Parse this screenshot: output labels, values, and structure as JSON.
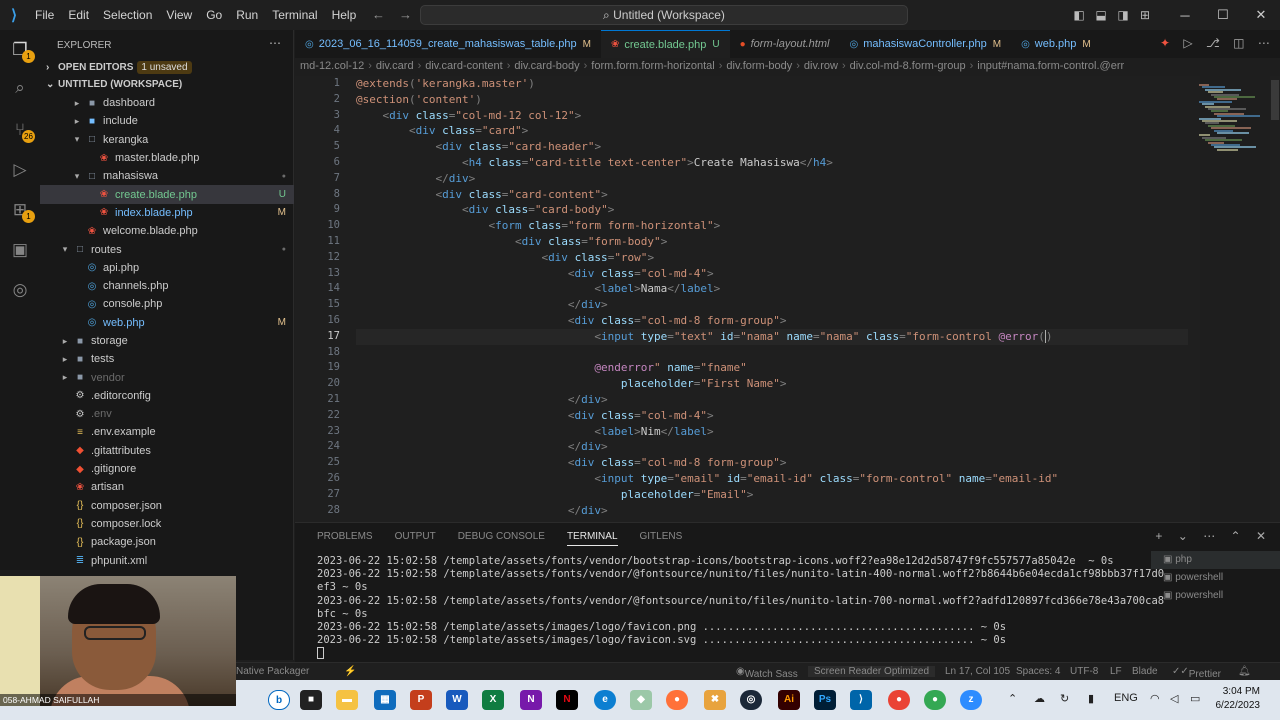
{
  "window": {
    "title": "Untitled (Workspace)",
    "menu": [
      "File",
      "Edit",
      "Selection",
      "View",
      "Go",
      "Run",
      "Terminal",
      "Help"
    ]
  },
  "sidebar": {
    "title": "EXPLORER",
    "open_editors": "OPEN EDITORS",
    "unsaved_badge": "1 unsaved",
    "workspace": "UNTITLED (WORKSPACE)",
    "tree": [
      {
        "label": "dashboard",
        "type": "folder",
        "indent": 2,
        "status": ""
      },
      {
        "label": "include",
        "type": "folder-blue",
        "indent": 2,
        "status": ""
      },
      {
        "label": "kerangka",
        "type": "folder-open",
        "indent": 2,
        "status": ""
      },
      {
        "label": "master.blade.php",
        "type": "blade",
        "indent": 3,
        "status": ""
      },
      {
        "label": "mahasiswa",
        "type": "folder-open",
        "indent": 2,
        "status": "dot"
      },
      {
        "label": "create.blade.php",
        "type": "blade",
        "indent": 3,
        "status": "U"
      },
      {
        "label": "index.blade.php",
        "type": "blade",
        "indent": 3,
        "status": "M"
      },
      {
        "label": "welcome.blade.php",
        "type": "blade",
        "indent": 2,
        "status": ""
      },
      {
        "label": "routes",
        "type": "folder-open",
        "indent": 1,
        "status": "dot"
      },
      {
        "label": "api.php",
        "type": "php",
        "indent": 2,
        "status": ""
      },
      {
        "label": "channels.php",
        "type": "php",
        "indent": 2,
        "status": ""
      },
      {
        "label": "console.php",
        "type": "php",
        "indent": 2,
        "status": ""
      },
      {
        "label": "web.php",
        "type": "php",
        "indent": 2,
        "status": "M"
      },
      {
        "label": "storage",
        "type": "folder",
        "indent": 1,
        "status": ""
      },
      {
        "label": "tests",
        "type": "folder",
        "indent": 1,
        "status": ""
      },
      {
        "label": "vendor",
        "type": "folder",
        "indent": 1,
        "status": ""
      },
      {
        "label": ".editorconfig",
        "type": "gear",
        "indent": 1,
        "status": ""
      },
      {
        "label": ".env",
        "type": "gear",
        "indent": 1,
        "status": ""
      },
      {
        "label": ".env.example",
        "type": "env",
        "indent": 1,
        "status": ""
      },
      {
        "label": ".gitattributes",
        "type": "git",
        "indent": 1,
        "status": ""
      },
      {
        "label": ".gitignore",
        "type": "git",
        "indent": 1,
        "status": ""
      },
      {
        "label": "artisan",
        "type": "blade",
        "indent": 1,
        "status": ""
      },
      {
        "label": "composer.json",
        "type": "json",
        "indent": 1,
        "status": ""
      },
      {
        "label": "composer.lock",
        "type": "json",
        "indent": 1,
        "status": ""
      },
      {
        "label": "package.json",
        "type": "json",
        "indent": 1,
        "status": ""
      },
      {
        "label": "phpunit.xml",
        "type": "xml",
        "indent": 1,
        "status": ""
      }
    ]
  },
  "tabs": [
    {
      "label": "2023_06_16_114059_create_mahasiswas_table.php",
      "mark": "M",
      "icon": "php",
      "active": false
    },
    {
      "label": "create.blade.php",
      "mark": "U",
      "icon": "blade",
      "active": true
    },
    {
      "label": "form-layout.html",
      "mark": "",
      "icon": "dot",
      "active": false
    },
    {
      "label": "mahasiswaController.php",
      "mark": "M",
      "icon": "php",
      "active": false
    },
    {
      "label": "web.php",
      "mark": "M",
      "icon": "php",
      "active": false
    }
  ],
  "breadcrumb": [
    "md-12.col-12",
    "div.card",
    "div.card-content",
    "div.card-body",
    "form.form.form-horizontal",
    "div.form-body",
    "div.row",
    "div.col-md-8.form-group",
    "input#nama.form-control.@err"
  ],
  "editor": {
    "current_line": 17,
    "lines": [
      [
        [
          "dir",
          "@extends"
        ],
        [
          "p",
          "("
        ],
        [
          "str",
          "'kerangka.master'"
        ],
        [
          "p",
          ")"
        ]
      ],
      [
        [
          "dir",
          "@section"
        ],
        [
          "p",
          "("
        ],
        [
          "str",
          "'content'"
        ],
        [
          "p",
          ")"
        ]
      ],
      [
        [
          "txt",
          "    "
        ],
        [
          "p",
          "<"
        ],
        [
          "tag",
          "div"
        ],
        [
          "txt",
          " "
        ],
        [
          "at",
          "class"
        ],
        [
          "p",
          "="
        ],
        [
          "str",
          "\"col-md-12 col-12\""
        ],
        [
          "p",
          ">"
        ]
      ],
      [
        [
          "txt",
          "        "
        ],
        [
          "p",
          "<"
        ],
        [
          "tag",
          "div"
        ],
        [
          "txt",
          " "
        ],
        [
          "at",
          "class"
        ],
        [
          "p",
          "="
        ],
        [
          "str",
          "\"card\""
        ],
        [
          "p",
          ">"
        ]
      ],
      [
        [
          "txt",
          "            "
        ],
        [
          "p",
          "<"
        ],
        [
          "tag",
          "div"
        ],
        [
          "txt",
          " "
        ],
        [
          "at",
          "class"
        ],
        [
          "p",
          "="
        ],
        [
          "str",
          "\"card-header\""
        ],
        [
          "p",
          ">"
        ]
      ],
      [
        [
          "txt",
          "                "
        ],
        [
          "p",
          "<"
        ],
        [
          "tag",
          "h4"
        ],
        [
          "txt",
          " "
        ],
        [
          "at",
          "class"
        ],
        [
          "p",
          "="
        ],
        [
          "str",
          "\"card-title text-center\""
        ],
        [
          "p",
          ">"
        ],
        [
          "txt",
          "Create Mahasiswa"
        ],
        [
          "p",
          "</"
        ],
        [
          "tag",
          "h4"
        ],
        [
          "p",
          ">"
        ]
      ],
      [
        [
          "txt",
          "            "
        ],
        [
          "p",
          "</"
        ],
        [
          "tag",
          "div"
        ],
        [
          "p",
          ">"
        ]
      ],
      [
        [
          "txt",
          "            "
        ],
        [
          "p",
          "<"
        ],
        [
          "tag",
          "div"
        ],
        [
          "txt",
          " "
        ],
        [
          "at",
          "class"
        ],
        [
          "p",
          "="
        ],
        [
          "str",
          "\"card-content\""
        ],
        [
          "p",
          ">"
        ]
      ],
      [
        [
          "txt",
          "                "
        ],
        [
          "p",
          "<"
        ],
        [
          "tag",
          "div"
        ],
        [
          "txt",
          " "
        ],
        [
          "at",
          "class"
        ],
        [
          "p",
          "="
        ],
        [
          "str",
          "\"card-body\""
        ],
        [
          "p",
          ">"
        ]
      ],
      [
        [
          "txt",
          "                    "
        ],
        [
          "p",
          "<"
        ],
        [
          "tag",
          "form"
        ],
        [
          "txt",
          " "
        ],
        [
          "at",
          "class"
        ],
        [
          "p",
          "="
        ],
        [
          "str",
          "\"form form-horizontal\""
        ],
        [
          "p",
          ">"
        ]
      ],
      [
        [
          "txt",
          "                        "
        ],
        [
          "p",
          "<"
        ],
        [
          "tag",
          "div"
        ],
        [
          "txt",
          " "
        ],
        [
          "at",
          "class"
        ],
        [
          "p",
          "="
        ],
        [
          "str",
          "\"form-body\""
        ],
        [
          "p",
          ">"
        ]
      ],
      [
        [
          "txt",
          "                            "
        ],
        [
          "p",
          "<"
        ],
        [
          "tag",
          "div"
        ],
        [
          "txt",
          " "
        ],
        [
          "at",
          "class"
        ],
        [
          "p",
          "="
        ],
        [
          "str",
          "\"row\""
        ],
        [
          "p",
          ">"
        ]
      ],
      [
        [
          "txt",
          "                                "
        ],
        [
          "p",
          "<"
        ],
        [
          "tag",
          "div"
        ],
        [
          "txt",
          " "
        ],
        [
          "at",
          "class"
        ],
        [
          "p",
          "="
        ],
        [
          "str",
          "\"col-md-4\""
        ],
        [
          "p",
          ">"
        ]
      ],
      [
        [
          "txt",
          "                                    "
        ],
        [
          "p",
          "<"
        ],
        [
          "tag",
          "label"
        ],
        [
          "p",
          ">"
        ],
        [
          "txt",
          "Nama"
        ],
        [
          "p",
          "</"
        ],
        [
          "tag",
          "label"
        ],
        [
          "p",
          ">"
        ]
      ],
      [
        [
          "txt",
          "                                "
        ],
        [
          "p",
          "</"
        ],
        [
          "tag",
          "div"
        ],
        [
          "p",
          ">"
        ]
      ],
      [
        [
          "txt",
          "                                "
        ],
        [
          "p",
          "<"
        ],
        [
          "tag",
          "div"
        ],
        [
          "txt",
          " "
        ],
        [
          "at",
          "class"
        ],
        [
          "p",
          "="
        ],
        [
          "str",
          "\"col-md-8 form-group\""
        ],
        [
          "p",
          ">"
        ]
      ],
      [
        [
          "txt",
          "                                    "
        ],
        [
          "p",
          "<"
        ],
        [
          "tag",
          "input"
        ],
        [
          "txt",
          " "
        ],
        [
          "at",
          "type"
        ],
        [
          "p",
          "="
        ],
        [
          "str",
          "\"text\""
        ],
        [
          "txt",
          " "
        ],
        [
          "at",
          "id"
        ],
        [
          "p",
          "="
        ],
        [
          "str",
          "\"nama\""
        ],
        [
          "txt",
          " "
        ],
        [
          "at",
          "name"
        ],
        [
          "p",
          "="
        ],
        [
          "str",
          "\"nama\""
        ],
        [
          "txt",
          " "
        ],
        [
          "at",
          "class"
        ],
        [
          "p",
          "="
        ],
        [
          "str",
          "\"form-control "
        ],
        [
          "blade",
          "@error"
        ],
        [
          "p",
          "("
        ],
        [
          "caret",
          ""
        ],
        [
          "p",
          ")"
        ]
      ],
      [
        [
          "txt",
          ""
        ]
      ],
      [
        [
          "txt",
          "                                    "
        ],
        [
          "blade",
          "@enderror"
        ],
        [
          "str",
          "\""
        ],
        [
          "txt",
          " "
        ],
        [
          "at",
          "name"
        ],
        [
          "p",
          "="
        ],
        [
          "str",
          "\"fname\""
        ]
      ],
      [
        [
          "txt",
          "                                        "
        ],
        [
          "at",
          "placeholder"
        ],
        [
          "p",
          "="
        ],
        [
          "str",
          "\"First Name\""
        ],
        [
          "p",
          ">"
        ]
      ],
      [
        [
          "txt",
          "                                "
        ],
        [
          "p",
          "</"
        ],
        [
          "tag",
          "div"
        ],
        [
          "p",
          ">"
        ]
      ],
      [
        [
          "txt",
          "                                "
        ],
        [
          "p",
          "<"
        ],
        [
          "tag",
          "div"
        ],
        [
          "txt",
          " "
        ],
        [
          "at",
          "class"
        ],
        [
          "p",
          "="
        ],
        [
          "str",
          "\"col-md-4\""
        ],
        [
          "p",
          ">"
        ]
      ],
      [
        [
          "txt",
          "                                    "
        ],
        [
          "p",
          "<"
        ],
        [
          "tag",
          "label"
        ],
        [
          "p",
          ">"
        ],
        [
          "txt",
          "Nim"
        ],
        [
          "p",
          "</"
        ],
        [
          "tag",
          "label"
        ],
        [
          "p",
          ">"
        ]
      ],
      [
        [
          "txt",
          "                                "
        ],
        [
          "p",
          "</"
        ],
        [
          "tag",
          "div"
        ],
        [
          "p",
          ">"
        ]
      ],
      [
        [
          "txt",
          "                                "
        ],
        [
          "p",
          "<"
        ],
        [
          "tag",
          "div"
        ],
        [
          "txt",
          " "
        ],
        [
          "at",
          "class"
        ],
        [
          "p",
          "="
        ],
        [
          "str",
          "\"col-md-8 form-group\""
        ],
        [
          "p",
          ">"
        ]
      ],
      [
        [
          "txt",
          "                                    "
        ],
        [
          "p",
          "<"
        ],
        [
          "tag",
          "input"
        ],
        [
          "txt",
          " "
        ],
        [
          "at",
          "type"
        ],
        [
          "p",
          "="
        ],
        [
          "str",
          "\"email\""
        ],
        [
          "txt",
          " "
        ],
        [
          "at",
          "id"
        ],
        [
          "p",
          "="
        ],
        [
          "str",
          "\"email-id\""
        ],
        [
          "txt",
          " "
        ],
        [
          "at",
          "class"
        ],
        [
          "p",
          "="
        ],
        [
          "str",
          "\"form-control\""
        ],
        [
          "txt",
          " "
        ],
        [
          "at",
          "name"
        ],
        [
          "p",
          "="
        ],
        [
          "str",
          "\"email-id\""
        ]
      ],
      [
        [
          "txt",
          "                                        "
        ],
        [
          "at",
          "placeholder"
        ],
        [
          "p",
          "="
        ],
        [
          "str",
          "\"Email\""
        ],
        [
          "p",
          ">"
        ]
      ],
      [
        [
          "txt",
          "                                "
        ],
        [
          "p",
          "</"
        ],
        [
          "tag",
          "div"
        ],
        [
          "p",
          ">"
        ]
      ]
    ]
  },
  "panel": {
    "tabs": [
      "PROBLEMS",
      "OUTPUT",
      "DEBUG CONSOLE",
      "TERMINAL",
      "GITLENS"
    ],
    "active_tab": "TERMINAL",
    "terminal_lines": [
      "2023-06-22 15:02:58 /template/assets/fonts/vendor/bootstrap-icons/bootstrap-icons.woff2?ea98e12d2d58747f9fc557577a85042e  ~ 0s",
      "2023-06-22 15:02:58 /template/assets/fonts/vendor/@fontsource/nunito/files/nunito-latin-400-normal.woff2?b8644b6e04ecda1cf98bbb37f17d0",
      "ef3 ~ 0s",
      "2023-06-22 15:02:58 /template/assets/fonts/vendor/@fontsource/nunito/files/nunito-latin-700-normal.woff2?adfd120897fcd366e78e43a700ca8",
      "bfc ~ 0s",
      "2023-06-22 15:02:58 /template/assets/images/logo/favicon.png ........................................... ~ 0s",
      "2023-06-22 15:02:58 /template/assets/images/logo/favicon.svg ........................................... ~ 0s"
    ],
    "terminals": [
      "php",
      "powershell",
      "powershell"
    ]
  },
  "status": {
    "left": "Native Packager",
    "watch": "Watch Sass",
    "screen_reader": "Screen Reader Optimized",
    "position": "Ln 17, Col 105",
    "spaces": "Spaces: 4",
    "encoding": "UTF-8",
    "eol": "LF",
    "language": "Blade",
    "prettier": "Prettier"
  },
  "taskbar": {
    "lang": "ENG",
    "time": "3:04 PM",
    "date": "6/22/2023"
  },
  "webcam": {
    "name": "058-AHMAD SAIFULLAH"
  },
  "colors": {
    "accent": "#0078d4",
    "modified": "#e2c08d",
    "untracked": "#73c991"
  }
}
